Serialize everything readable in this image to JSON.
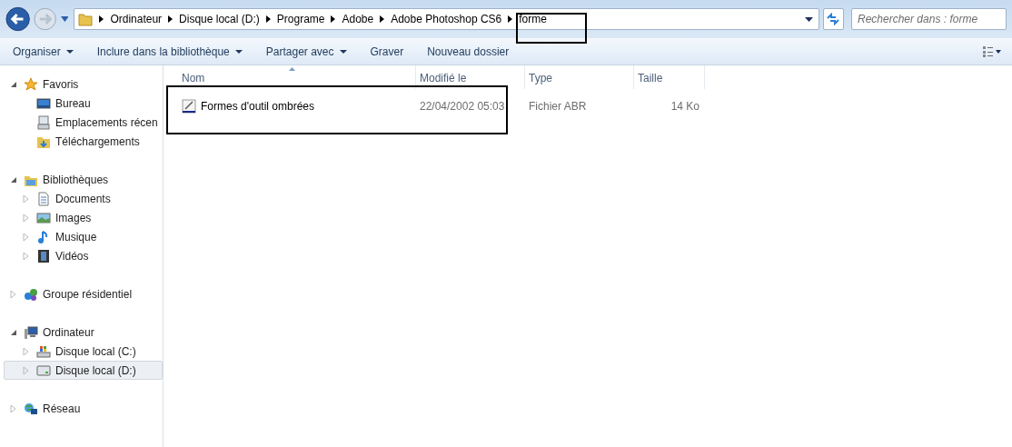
{
  "address_bar": {
    "crumbs": [
      "Ordinateur",
      "Disque local (D:)",
      "Programe",
      "Adobe",
      "Adobe Photoshop CS6",
      "forme"
    ]
  },
  "search": {
    "placeholder": "Rechercher dans : forme"
  },
  "toolbar": [
    {
      "label": "Organiser",
      "dropdown": true
    },
    {
      "label": "Inclure dans la bibliothèque",
      "dropdown": true
    },
    {
      "label": "Partager avec",
      "dropdown": true
    },
    {
      "label": "Graver",
      "dropdown": false
    },
    {
      "label": "Nouveau dossier",
      "dropdown": false
    }
  ],
  "sidebar": {
    "groups": [
      {
        "label": "Favoris",
        "expanded": true,
        "selected": false,
        "children": [
          {
            "label": "Bureau",
            "expandable": false,
            "selected": false
          },
          {
            "label": "Emplacements récen",
            "expandable": false,
            "selected": false
          },
          {
            "label": "Téléchargements",
            "expandable": false,
            "selected": false
          }
        ]
      },
      {
        "label": "Bibliothèques",
        "expanded": true,
        "selected": false,
        "children": [
          {
            "label": "Documents",
            "expandable": true,
            "selected": false
          },
          {
            "label": "Images",
            "expandable": true,
            "selected": false
          },
          {
            "label": "Musique",
            "expandable": true,
            "selected": false
          },
          {
            "label": "Vidéos",
            "expandable": true,
            "selected": false
          }
        ]
      },
      {
        "label": "Groupe résidentiel",
        "expanded": false,
        "selected": false
      },
      {
        "label": "Ordinateur",
        "expanded": true,
        "selected": false,
        "children": [
          {
            "label": "Disque local (C:)",
            "expandable": true,
            "selected": false
          },
          {
            "label": "Disque local (D:)",
            "expandable": true,
            "selected": true
          }
        ]
      },
      {
        "label": "Réseau",
        "expanded": false,
        "selected": false
      }
    ]
  },
  "table": {
    "columns": [
      "Nom",
      "Modifié le",
      "Type",
      "Taille"
    ],
    "rows": [
      {
        "name": "Formes d'outil ombrées",
        "modified": "22/04/2002 05:03",
        "type": "Fichier ABR",
        "size": "14 Ko"
      }
    ]
  }
}
